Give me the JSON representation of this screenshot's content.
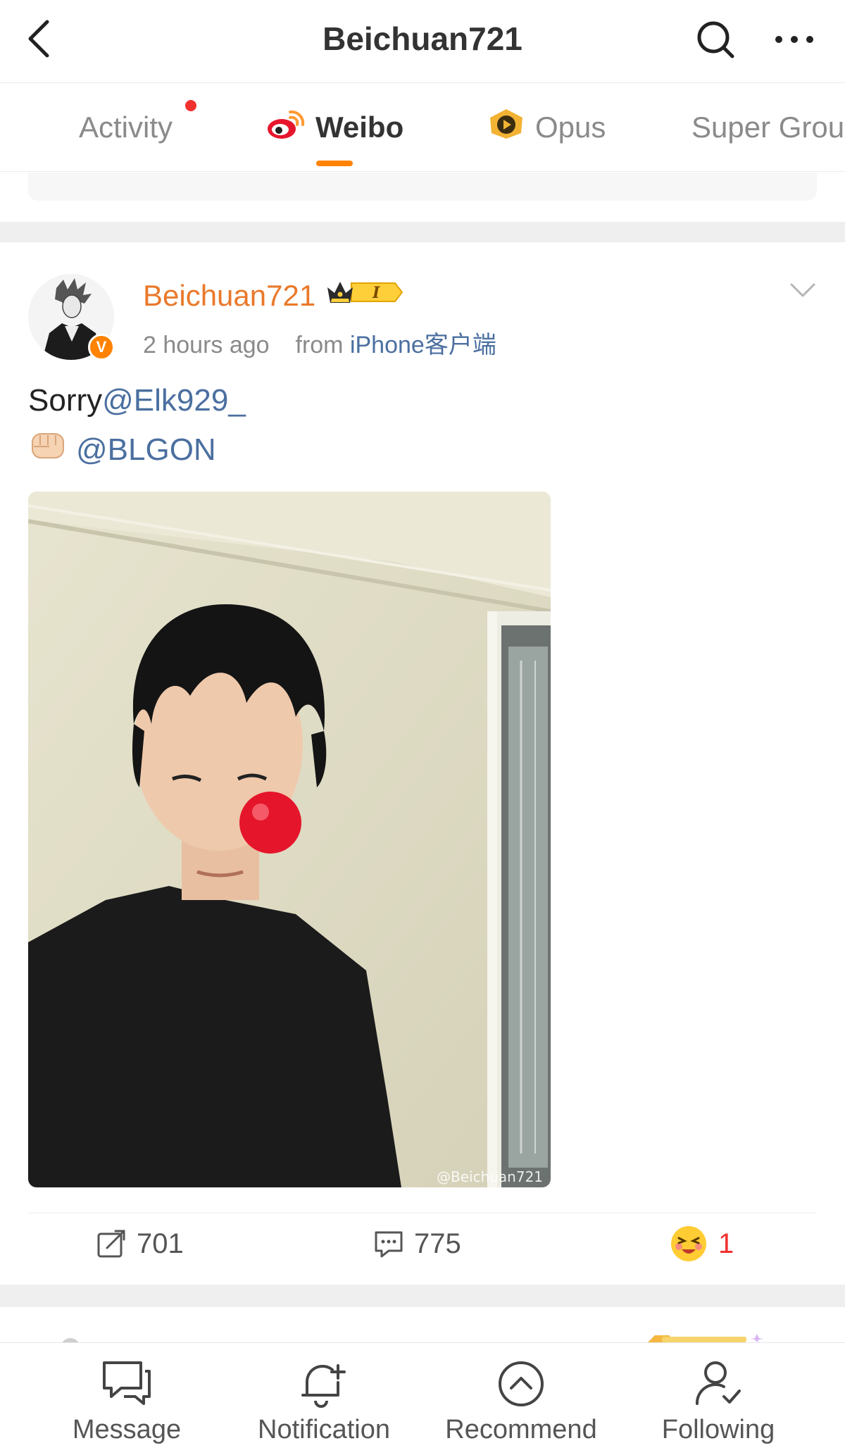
{
  "header": {
    "title": "Beichuan721",
    "back_icon": "chevron-left-icon",
    "search_icon": "search-icon",
    "more_icon": "more-dots-icon"
  },
  "tabs": [
    {
      "label": "Activity",
      "has_notification_dot": true
    },
    {
      "label": "Weibo",
      "icon": "weibo-logo-icon",
      "active": true
    },
    {
      "label": "Opus",
      "icon": "opus-play-icon"
    },
    {
      "label": "Super Grou"
    }
  ],
  "post": {
    "username": "Beichuan721",
    "verified_badge": "V",
    "time": "2 hours ago",
    "from_label": "from",
    "source": "iPhone客户端",
    "text_line1_prefix": "Sorry",
    "text_line1_mention": "@Elk929_",
    "text_line2_mention": "@BLGON",
    "image_watermark": "@Beichuan721",
    "reposts": "701",
    "comments": "775",
    "likes": "1"
  },
  "bottom_nav": [
    {
      "label": "Message",
      "icon": "message-icon"
    },
    {
      "label": "Notification",
      "icon": "bell-plus-icon"
    },
    {
      "label": "Recommend",
      "icon": "chevron-up-circle-icon"
    },
    {
      "label": "Following",
      "icon": "user-check-icon"
    }
  ],
  "colors": {
    "accent": "#ff8200",
    "username": "#e9792b",
    "link": "#4b6fa0",
    "like": "#f0312f"
  }
}
